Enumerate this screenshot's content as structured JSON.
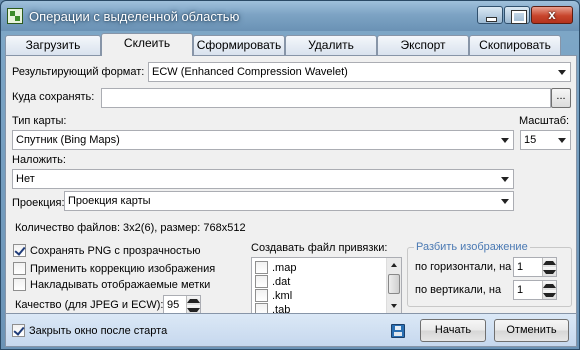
{
  "window": {
    "title": "Операции с выделенной областью",
    "close_glyph": "x"
  },
  "tabs": [
    {
      "label": "Загрузить",
      "active": false
    },
    {
      "label": "Склеить",
      "active": true
    },
    {
      "label": "Сформировать",
      "active": false
    },
    {
      "label": "Удалить",
      "active": false
    },
    {
      "label": "Экспорт",
      "active": false
    },
    {
      "label": "Скопировать",
      "active": false
    }
  ],
  "form": {
    "format_label": "Результирующий формат:",
    "format_value": "ECW (Enhanced Compression Wavelet)",
    "save_to_label": "Куда сохранять:",
    "save_to_value": "",
    "browse_label": "...",
    "map_type_label": "Тип карты:",
    "map_type_value": "Спутник (Bing Maps)",
    "scale_label": "Масштаб:",
    "scale_value": "15",
    "overlay_label": "Наложить:",
    "overlay_value": "Нет",
    "projection_label": "Проекция:",
    "projection_value": "Проекция карты",
    "file_count_text": "Количество файлов: 3x2(6), размер: 768x512"
  },
  "options": {
    "save_png_alpha": {
      "label": "Сохранять  PNG с прозрачностью",
      "checked": true
    },
    "image_correction": {
      "label": "Применить коррекцию изображения",
      "checked": false
    },
    "overlay_marks": {
      "label": "Накладывать отображаемые метки",
      "checked": false
    },
    "quality_label": "Качество (для JPEG и ECW):",
    "quality_value": "95"
  },
  "georef": {
    "label": "Создавать файл привязки:",
    "items": [
      {
        "label": ".map",
        "checked": false
      },
      {
        "label": ".dat",
        "checked": false
      },
      {
        "label": ".kml",
        "checked": false
      },
      {
        "label": ".tab",
        "checked": false
      }
    ]
  },
  "split": {
    "title": "Разбить изображение",
    "horizontal_label": "по горизонтали, на",
    "horizontal_value": "1",
    "vertical_label": "по вертикали, на",
    "vertical_value": "1"
  },
  "footer": {
    "close_after_start": {
      "label": "Закрыть окно после старта",
      "checked": true
    },
    "start_label": "Начать",
    "cancel_label": "Отменить"
  },
  "colors": {
    "group_title": "#4a79b3",
    "titlebar": "#7da3c4",
    "close_button": "#c8452c"
  },
  "icons": [
    "app-icon",
    "minimize-icon",
    "maximize-icon",
    "close-icon",
    "chevron-down-icon",
    "save-icon",
    "spin-up-icon",
    "spin-down-icon",
    "scroll-up-icon",
    "scroll-down-icon"
  ]
}
